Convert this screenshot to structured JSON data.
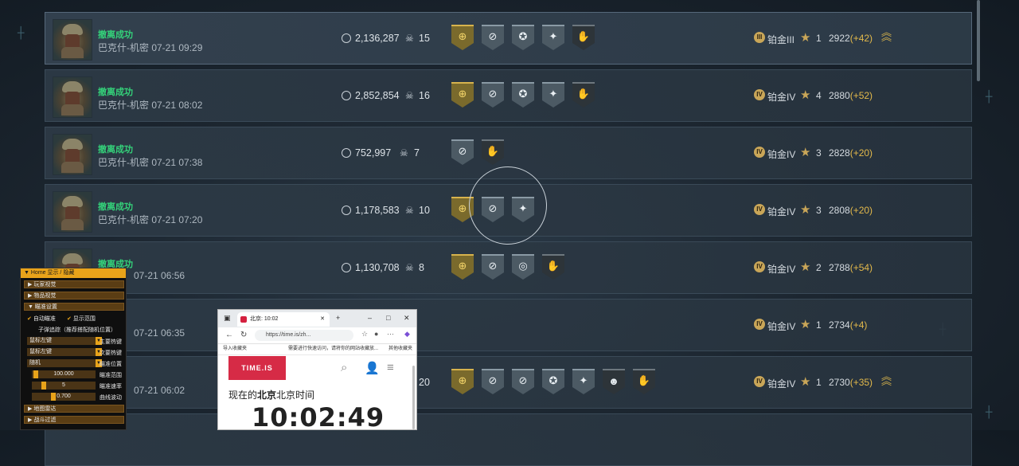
{
  "rows": [
    {
      "status": "撤离成功",
      "meta": "巴克什-机密 07-21 09:29",
      "money": "2,136,287",
      "kills": "15",
      "rank_numeral": "III",
      "rank": "铂金III",
      "stars": "1",
      "score": "2922",
      "delta": "(+42)"
    },
    {
      "status": "撤离成功",
      "meta": "巴克什-机密 07-21 08:02",
      "money": "2,852,854",
      "kills": "16",
      "rank_numeral": "IV",
      "rank": "铂金IV",
      "stars": "4",
      "score": "2880",
      "delta": "(+52)"
    },
    {
      "status": "撤离成功",
      "meta": "巴克什-机密 07-21 07:38",
      "money": "752,997",
      "kills": "7",
      "rank_numeral": "IV",
      "rank": "铂金IV",
      "stars": "3",
      "score": "2828",
      "delta": "(+20)"
    },
    {
      "status": "撤离成功",
      "meta": "巴克什-机密 07-21 07:20",
      "money": "1,178,583",
      "kills": "10",
      "rank_numeral": "IV",
      "rank": "铂金IV",
      "stars": "3",
      "score": "2808",
      "delta": "(+20)"
    },
    {
      "status": "撤离成功",
      "meta": "07-21 06:56",
      "money": "1,130,708",
      "kills": "8",
      "rank_numeral": "IV",
      "rank": "铂金IV",
      "stars": "2",
      "score": "2788",
      "delta": "(+54)"
    },
    {
      "status": "",
      "meta": "07-21 06:35",
      "money": "",
      "kills": "",
      "rank_numeral": "IV",
      "rank": "铂金IV",
      "stars": "1",
      "score": "2734",
      "delta": "(+4)"
    },
    {
      "status": "",
      "meta": "07-21 06:02",
      "money": "",
      "kills": "20",
      "rank_numeral": "IV",
      "rank": "铂金IV",
      "stars": "1",
      "score": "2730",
      "delta": "(+35)"
    }
  ],
  "panel": {
    "title": "Home 显示 / 隐藏",
    "sections": {
      "players": "玩家视觉",
      "items": "物品视觉",
      "aim": "瞄准设置",
      "map": "地图雷达",
      "combat": "战斗过滤"
    },
    "auto_aim": "自动瞄准",
    "show_range": "显示范围",
    "bullet_track": "子弹追踪（推荐搭配随机位置）",
    "primary_key_value": "鼠标左键",
    "primary_key_label": "主要热键",
    "secondary_key_value": "鼠标左键",
    "secondary_key_label": "次要热键",
    "aim_pos_value": "随机",
    "aim_pos_label": "瞄准位置",
    "range_value": "100.000",
    "range_label": "瞄准范围",
    "speed_value": "5",
    "speed_label": "瞄准速率",
    "curve_value": "0.700",
    "curve_label": "曲线波动"
  },
  "browser": {
    "tab_title": "北京: 10:02",
    "url": "https://time.is/zh...",
    "bookmark_import": "导入收藏夹",
    "bookmark_hint": "需要进行快速访问，请将你的网站收藏放...",
    "bookmark_other": "其他收藏夹",
    "logo": "TIME.IS",
    "headline_pre": "现在的",
    "headline_city": "北京",
    "headline_post": "北京时间",
    "time": "10:02:49"
  },
  "colors": {
    "success": "#34d27a",
    "gold": "#d7b34d",
    "delta": "#e3b94b",
    "panel_accent": "#e8a31a",
    "logo_red": "#d62b46"
  }
}
